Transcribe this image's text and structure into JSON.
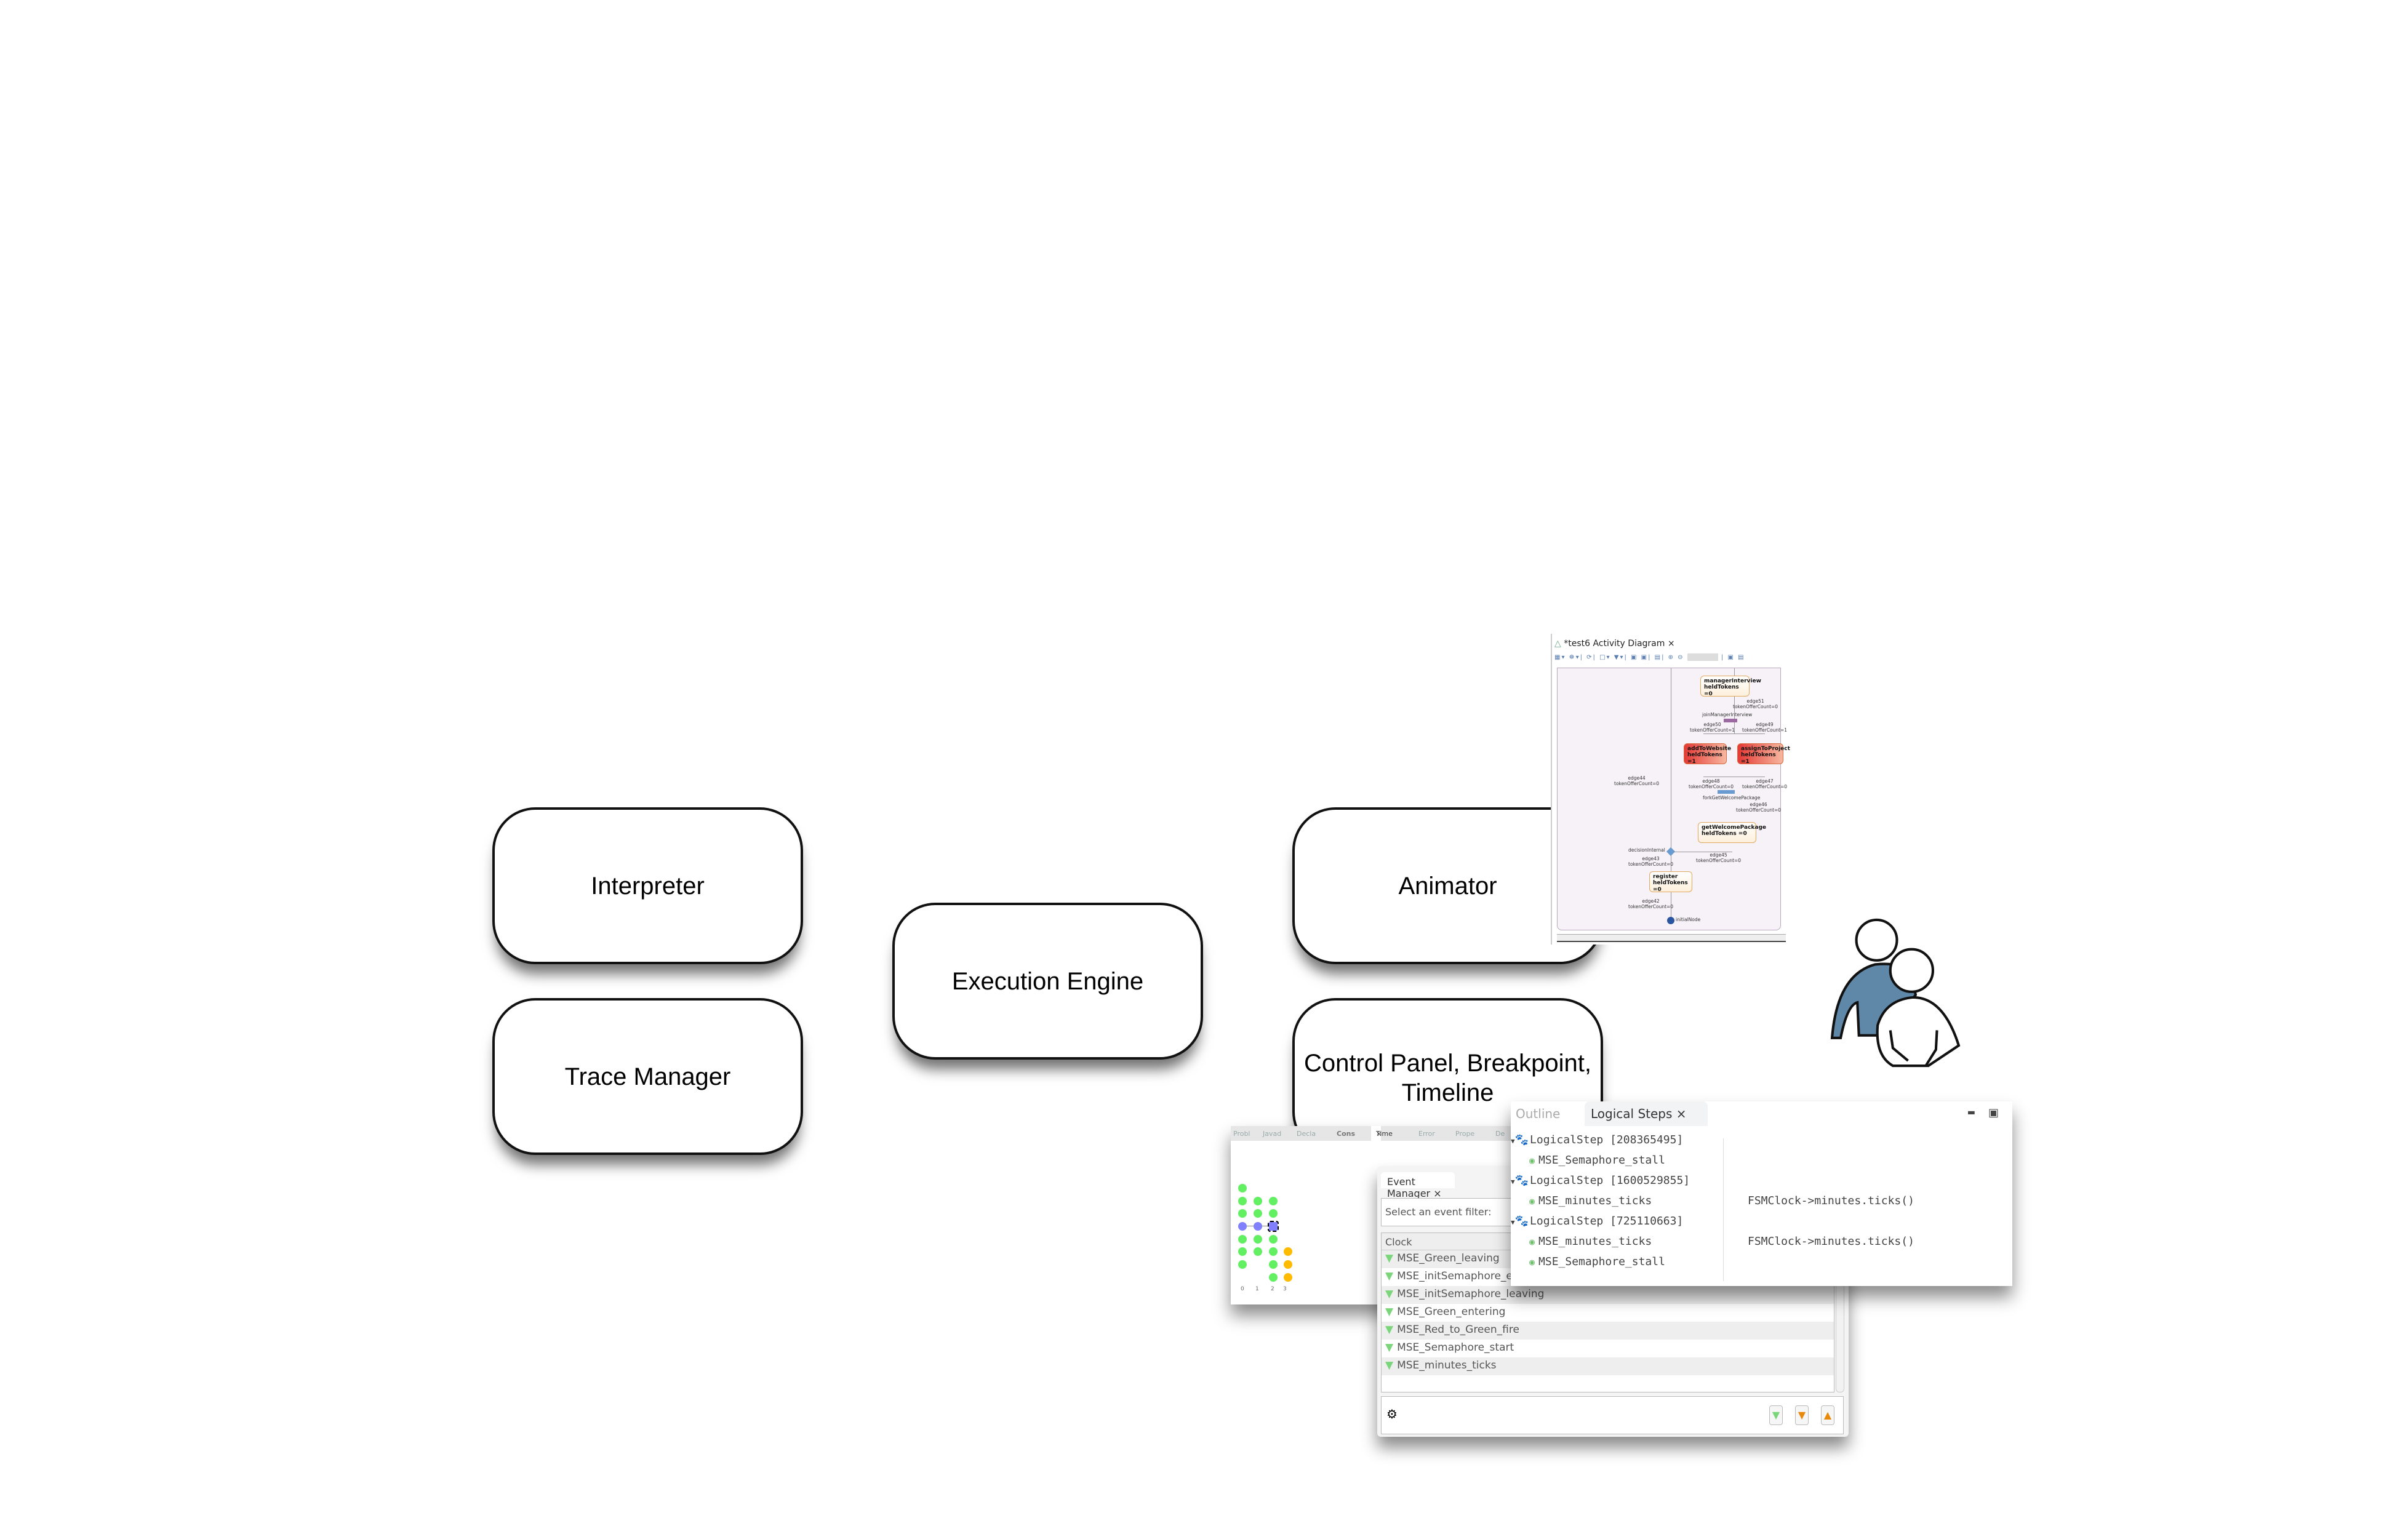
{
  "diagram": {
    "boxes": {
      "interpreter": "Interpreter",
      "trace_manager": "Trace Manager",
      "execution_engine": "Execution Engine",
      "animator": "Animator",
      "control_panel": "Control Panel, Breakpoint, Timeline"
    },
    "colors": {
      "actor_body": "#5f87a8",
      "box_border": "#111111"
    }
  },
  "activity_diagram": {
    "tab_title": "*test6 Activity Diagram",
    "nodes": [
      {
        "name": "managerInterview",
        "tokens": "heldTokens =0",
        "active": false
      },
      {
        "name": "addToWebsite",
        "tokens": "heldTokens =1",
        "active": true
      },
      {
        "name": "assignToProject",
        "tokens": "heldTokens =1",
        "active": true
      },
      {
        "name": "getWelcomePackage",
        "tokens": "heldTokens =0",
        "active": false
      },
      {
        "name": "register",
        "tokens": "heldTokens =0",
        "active": false
      }
    ],
    "edges": [
      {
        "name": "edge51",
        "count": "tokenOfferCount=0"
      },
      {
        "name": "edge50",
        "count": "tokenOfferCount=1"
      },
      {
        "name": "edge49",
        "count": "tokenOfferCount=1"
      },
      {
        "name": "edge48",
        "count": "tokenOfferCount=0"
      },
      {
        "name": "edge47",
        "count": "tokenOfferCount=0"
      },
      {
        "name": "edge46",
        "count": "tokenOfferCount=0"
      },
      {
        "name": "edge45",
        "count": "tokenOfferCount=0"
      },
      {
        "name": "edge44",
        "count": "tokenOfferCount=0"
      },
      {
        "name": "edge43",
        "count": "tokenOfferCount=0"
      },
      {
        "name": "edge42",
        "count": "tokenOfferCount=0"
      }
    ],
    "join": "joinManagerInterview",
    "fork": "forkGetWelcomePackage",
    "decision": "decisionInternal",
    "initial": "initialNode"
  },
  "timeline": {
    "tabs": [
      "Probl",
      "Javad",
      "Decla",
      "Cons",
      "Time",
      "Error",
      "Prope",
      "De"
    ],
    "active_tab": "Time",
    "ticks": [
      "0",
      "1",
      "2",
      "3"
    ]
  },
  "event_manager": {
    "tab": "Event Manager",
    "filter_placeholder": "Select an event filter:",
    "column": "Clock",
    "events": [
      "MSE_Green_leaving",
      "MSE_initSemaphore_entering",
      "MSE_initSemaphore_leaving",
      "MSE_Green_entering",
      "MSE_Red_to_Green_fire",
      "MSE_Semaphore_start",
      "MSE_minutes_ticks"
    ]
  },
  "logical_steps": {
    "tabs": {
      "outline": "Outline",
      "logical": "Logical Steps"
    },
    "rows": [
      {
        "type": "step",
        "text": "LogicalStep [208365495]",
        "detail": ""
      },
      {
        "type": "event",
        "text": "MSE_Semaphore_stall",
        "detail": ""
      },
      {
        "type": "step",
        "text": "LogicalStep [1600529855]",
        "detail": ""
      },
      {
        "type": "event",
        "text": "MSE_minutes_ticks",
        "detail": "FSMClock->minutes.ticks()"
      },
      {
        "type": "step",
        "text": "LogicalStep [725110663]",
        "detail": ""
      },
      {
        "type": "event",
        "text": "MSE_minutes_ticks",
        "detail": "FSMClock->minutes.ticks()"
      },
      {
        "type": "event",
        "text": "MSE_Semaphore_stall",
        "detail": ""
      }
    ]
  }
}
